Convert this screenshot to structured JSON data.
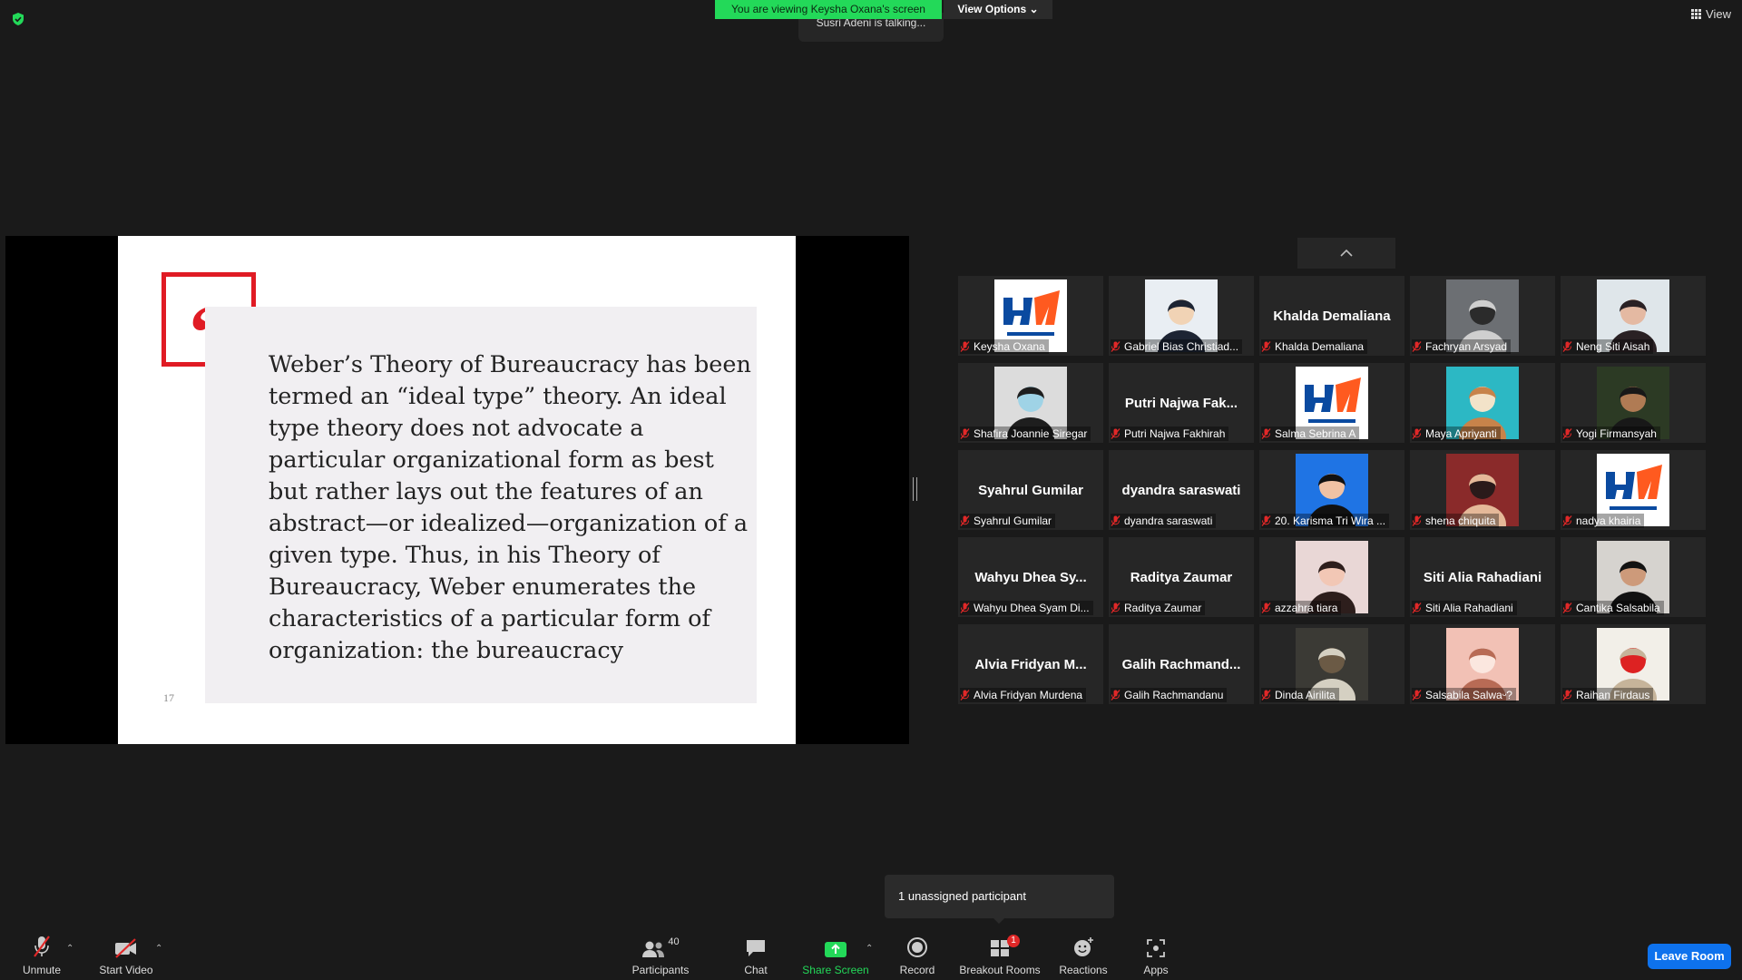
{
  "banner": {
    "viewing": "You are viewing Keysha Oxana's screen",
    "view_options": "View Options",
    "talking": "Susri Adeni is talking..."
  },
  "top_right": {
    "view_label": "View"
  },
  "slide": {
    "quote_mark": "“",
    "text": "Weber’s Theory of Bureaucracy has been termed an “ideal type” theory. An ideal type theory does not advocate a particular organizational form as best but rather lays out the features of an abstract—or idealized—organization of a given type. Thus, in his Theory of Bureaucracy, Weber enumerates the characteristics of a particular form of organization: the bureaucracy",
    "page_number": "17"
  },
  "participants": [
    {
      "name": "Keysha Oxana",
      "display": "",
      "avatar": "logo"
    },
    {
      "name": "Gabriel Bias Christiad...",
      "display": "",
      "avatar": "suit"
    },
    {
      "name": "Khalda Demaliana",
      "display": "Khalda Demaliana",
      "avatar": ""
    },
    {
      "name": "Fachryan Arsyad",
      "display": "",
      "avatar": "crowd"
    },
    {
      "name": "Neng Siti Aisah",
      "display": "",
      "avatar": "portrait-light"
    },
    {
      "name": "Shafira Joannie Siregar",
      "display": "",
      "avatar": "mask"
    },
    {
      "name": "Putri Najwa Fakhirah",
      "display": "Putri Najwa Fak...",
      "avatar": ""
    },
    {
      "name": "Salma Sebrina A",
      "display": "",
      "avatar": "logo"
    },
    {
      "name": "Maya Apriyanti",
      "display": "",
      "avatar": "giraffe"
    },
    {
      "name": "Yogi Firmansyah",
      "display": "",
      "avatar": "dark-hair"
    },
    {
      "name": "Syahrul Gumilar",
      "display": "Syahrul Gumilar",
      "avatar": ""
    },
    {
      "name": "dyandra saraswati",
      "display": "dyandra saraswati",
      "avatar": ""
    },
    {
      "name": "20. Karisma Tri Wira ...",
      "display": "",
      "avatar": "blue-bg"
    },
    {
      "name": "shena chiquita",
      "display": "",
      "avatar": "group"
    },
    {
      "name": "nadya khairia",
      "display": "",
      "avatar": "logo"
    },
    {
      "name": "Wahyu Dhea Syam Di...",
      "display": "Wahyu Dhea Sy...",
      "avatar": ""
    },
    {
      "name": "Raditya Zaumar",
      "display": "Raditya Zaumar",
      "avatar": ""
    },
    {
      "name": "azzahra tiara",
      "display": "",
      "avatar": "selfie"
    },
    {
      "name": "Siti Alia Rahadiani",
      "display": "Siti Alia Rahadiani",
      "avatar": ""
    },
    {
      "name": "Cantika Salsabila",
      "display": "",
      "avatar": "dark-hair2"
    },
    {
      "name": "Alvia Fridyan Murdena",
      "display": "Alvia Fridyan M...",
      "avatar": ""
    },
    {
      "name": "Galih Rachmandanu",
      "display": "Galih  Rachmand...",
      "avatar": ""
    },
    {
      "name": "Dinda Airilita",
      "display": "",
      "avatar": "room"
    },
    {
      "name": "Salsabila Salwaᵕ?",
      "display": "",
      "avatar": "pink"
    },
    {
      "name": "Raihan Firdaus",
      "display": "",
      "avatar": "anime"
    }
  ],
  "tooltip": {
    "text": "1 unassigned participant"
  },
  "toolbar": {
    "unmute": "Unmute",
    "start_video": "Start Video",
    "participants": "Participants",
    "participants_count": "40",
    "chat": "Chat",
    "share_screen": "Share Screen",
    "record": "Record",
    "breakout_rooms": "Breakout Rooms",
    "breakout_badge": "1",
    "reactions": "Reactions",
    "apps": "Apps",
    "leave_room": "Leave Room"
  },
  "colors": {
    "accent_green": "#23d959",
    "leave_blue": "#0e72ed",
    "mute_red": "#e02828",
    "quote_red": "#e01b24"
  }
}
